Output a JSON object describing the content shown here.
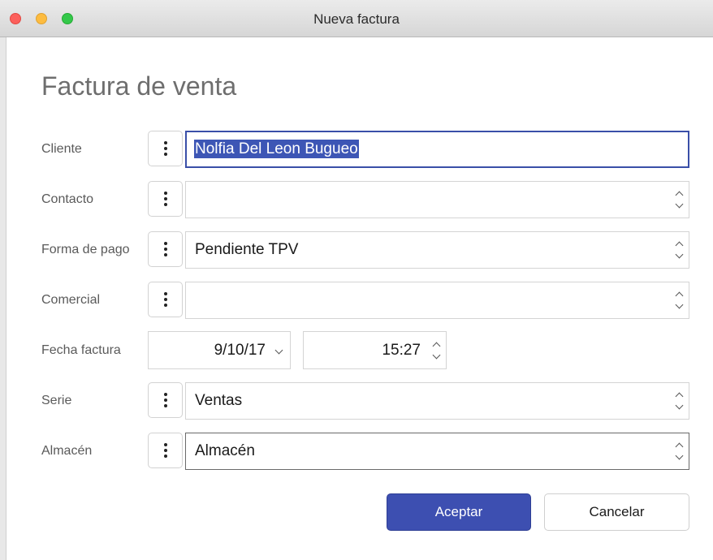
{
  "window": {
    "title": "Nueva factura"
  },
  "form": {
    "heading": "Factura de venta",
    "cliente": {
      "label": "Cliente",
      "value": "Nolfia Del Leon Bugueo"
    },
    "contacto": {
      "label": "Contacto",
      "value": ""
    },
    "forma_pago": {
      "label": "Forma de pago",
      "value": "Pendiente TPV"
    },
    "comercial": {
      "label": "Comercial",
      "value": ""
    },
    "fecha": {
      "label": "Fecha factura",
      "date": "9/10/17",
      "time": "15:27"
    },
    "serie": {
      "label": "Serie",
      "value": "Ventas"
    },
    "almacen": {
      "label": "Almacén",
      "value": "Almacén"
    }
  },
  "buttons": {
    "accept": "Aceptar",
    "cancel": "Cancelar"
  },
  "colors": {
    "accent": "#3d4fb1",
    "focus_border": "#3a4fa8"
  }
}
